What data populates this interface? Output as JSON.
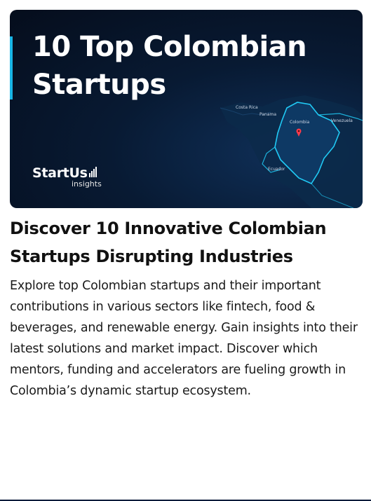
{
  "hero": {
    "title": "10 Top Colombian Startups",
    "brand_logo_text": "StartUs",
    "brand_sub": "insights",
    "map_labels": {
      "costa_rica": "Costa Rica",
      "panama": "Panama",
      "colombia": "Colombia",
      "venezuela": "Venezuela",
      "ecuador": "Ecuador"
    },
    "accent_color": "#18b5e6",
    "background_color": "#081a33"
  },
  "article": {
    "heading": "Discover 10 Innovative Colombian Startups Disrupting Industries",
    "description": "Explore top Colombian startups and their important contributions in various sectors like fintech, food & beverages, and renewable energy. Gain insights into their latest solutions and market impact. Discover which mentors, funding and accelerators are fueling growth in Colombia’s dynamic startup ecosystem."
  }
}
